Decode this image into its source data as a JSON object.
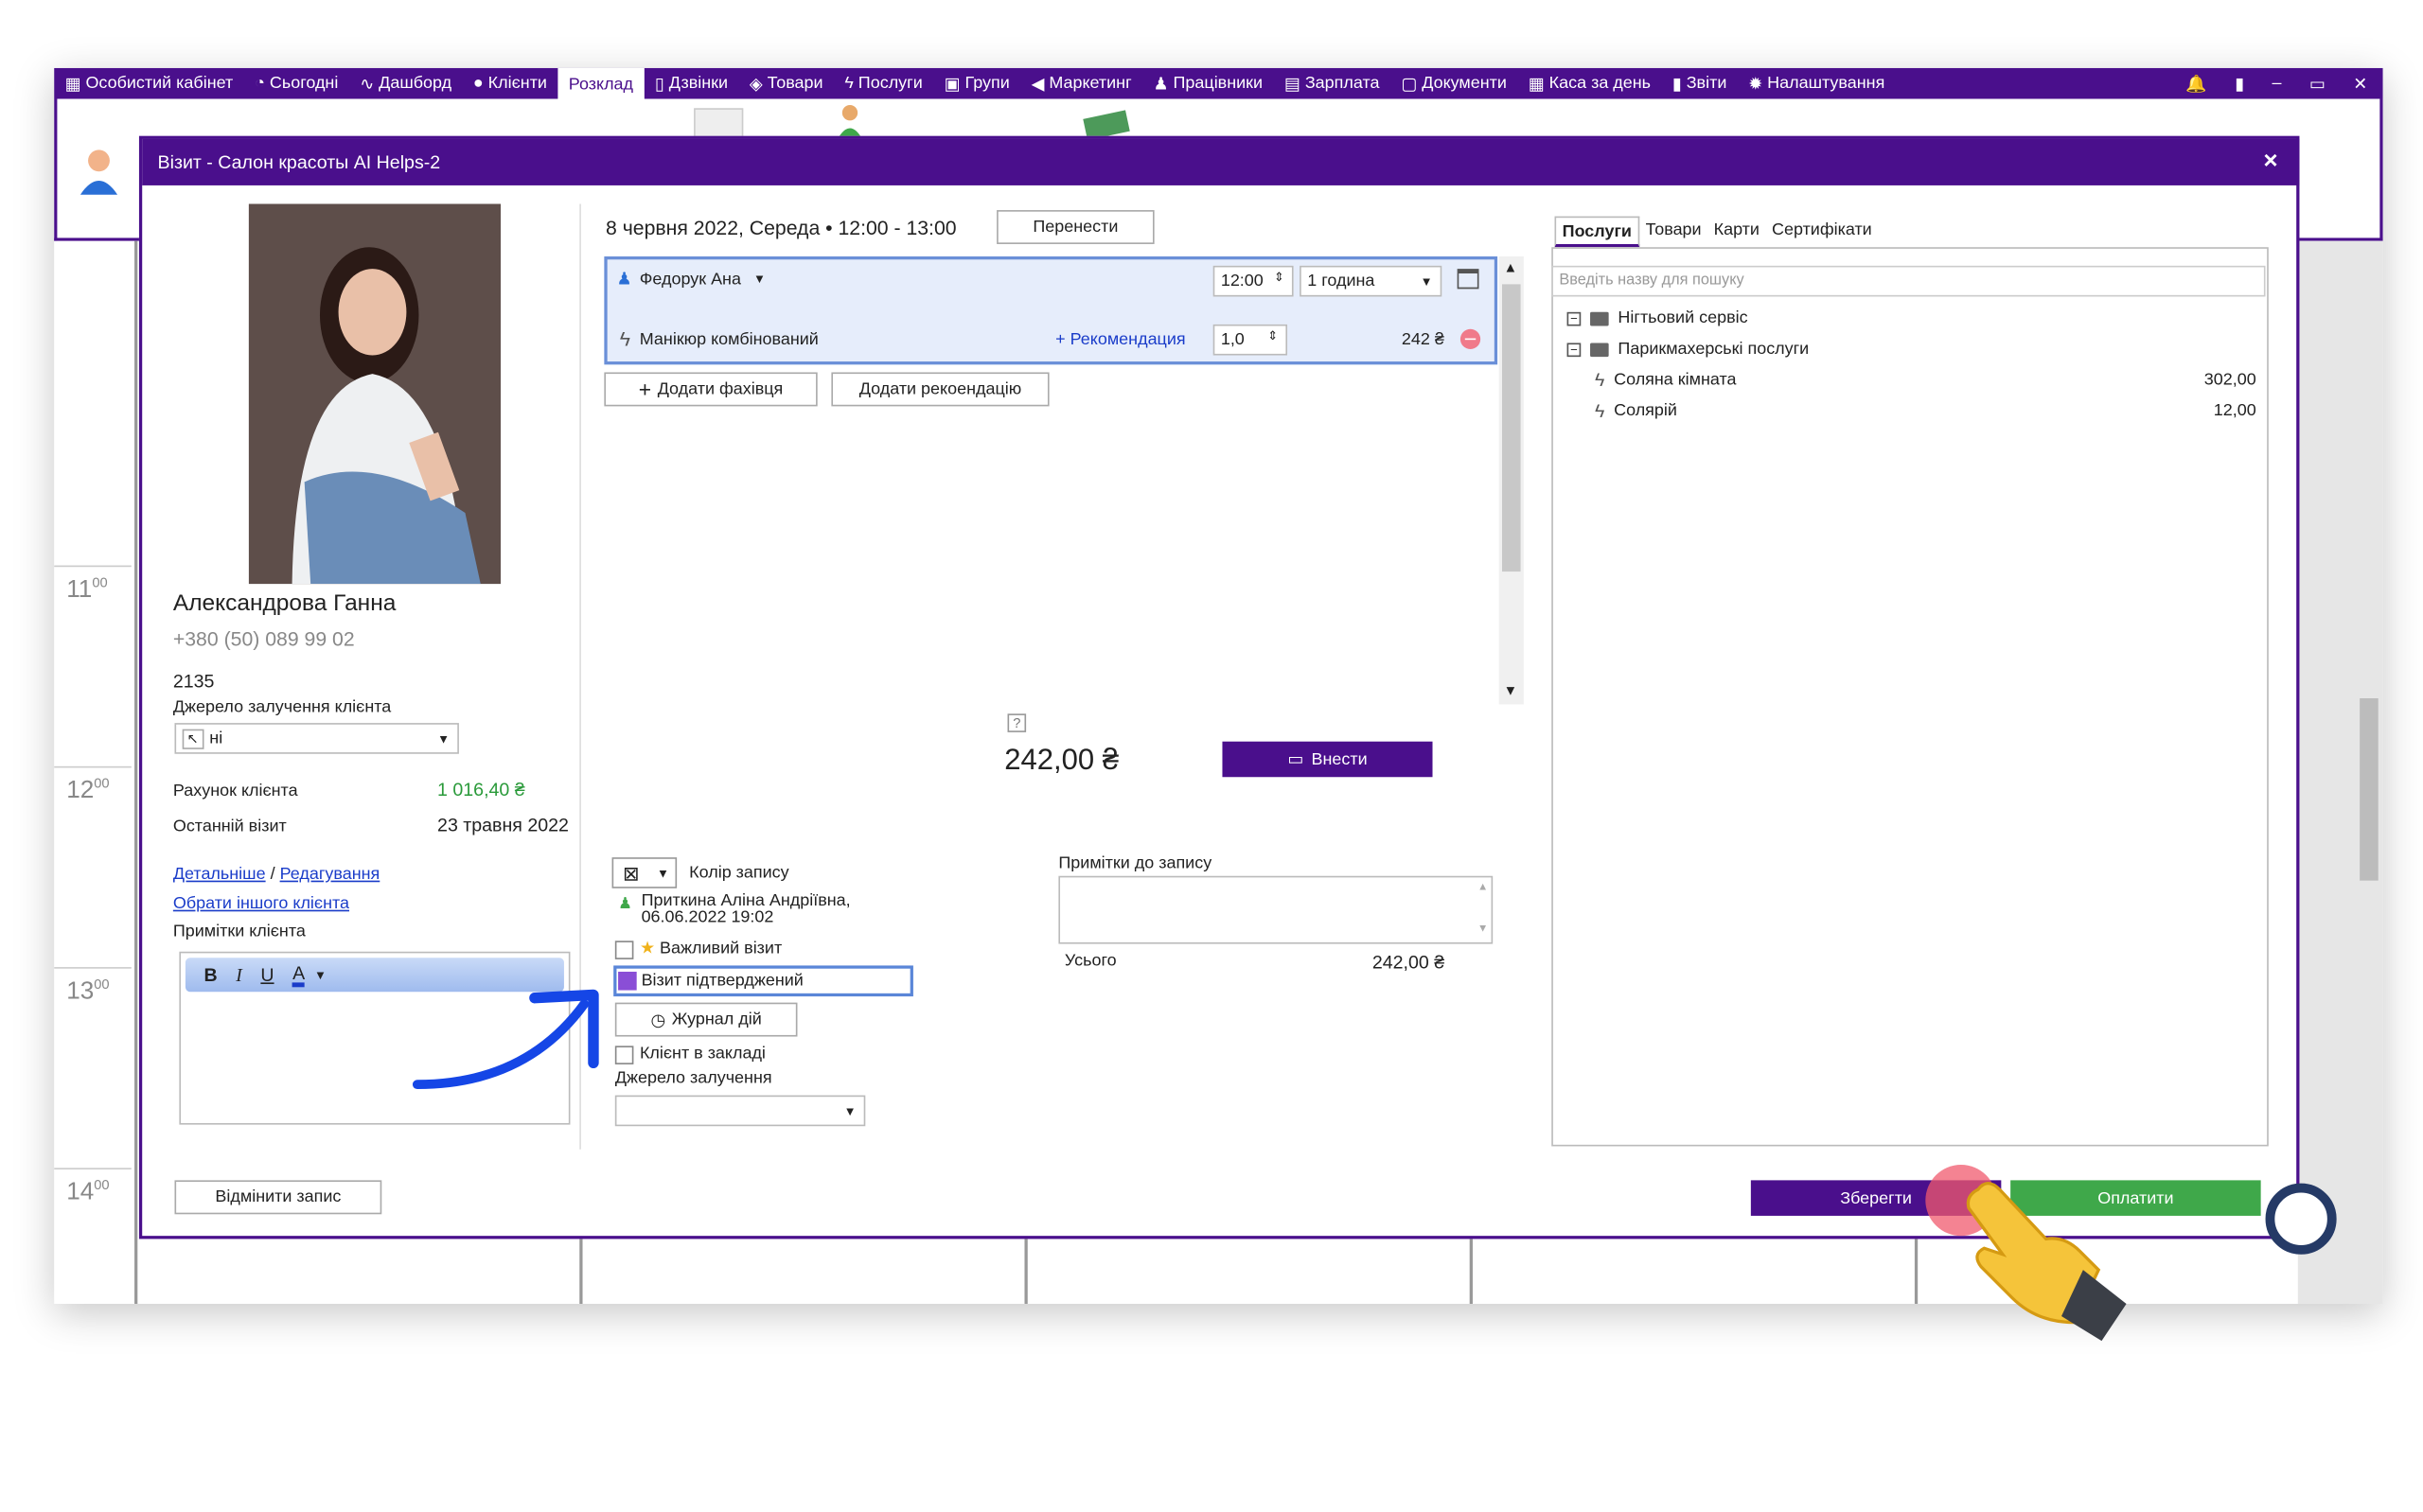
{
  "topmenu": [
    {
      "icon": "briefcase-icon",
      "glyph": "▦",
      "label": "Особистий кабінет"
    },
    {
      "icon": "clock-icon",
      "glyph": "◔",
      "label": "Сьогодні"
    },
    {
      "icon": "pulse-icon",
      "glyph": "∿",
      "label": "Дашборд"
    },
    {
      "icon": "user-circle-icon",
      "glyph": "●",
      "label": "Клієнти"
    },
    {
      "icon": "",
      "glyph": "",
      "label": "Розклад"
    },
    {
      "icon": "phone-icon",
      "glyph": "▯",
      "label": "Дзвінки"
    },
    {
      "icon": "box-icon",
      "glyph": "◈",
      "label": "Товари"
    },
    {
      "icon": "bolt-icon",
      "glyph": "ϟ",
      "label": "Послуги"
    },
    {
      "icon": "groups-icon",
      "glyph": "▣",
      "label": "Групи"
    },
    {
      "icon": "megaphone-icon",
      "glyph": "◀",
      "label": "Маркетинг"
    },
    {
      "icon": "person-icon",
      "glyph": "♟",
      "label": "Працівники"
    },
    {
      "icon": "money-icon",
      "glyph": "▤",
      "label": "Зарплата"
    },
    {
      "icon": "document-icon",
      "glyph": "▢",
      "label": "Документи"
    },
    {
      "icon": "calculator-icon",
      "glyph": "▦",
      "label": "Каса за день"
    },
    {
      "icon": "bars-icon",
      "glyph": "▮",
      "label": "Звіти"
    },
    {
      "icon": "gear-icon",
      "glyph": "✹",
      "label": "Налаштування"
    }
  ],
  "calendar_hours": [
    "11",
    "12",
    "13",
    "14"
  ],
  "calendar_minutes": "00",
  "modal": {
    "title": "Візит - Салон красоты AI Helps-2",
    "close": "×"
  },
  "client": {
    "name": "Александрова Ганна",
    "phone": "+380 (50) 089 99 02",
    "code": "2135",
    "source_label": "Джерело залучення клієнта",
    "source_value": "ні",
    "account_label": "Рахунок клієнта",
    "account_value": "1 016,40 ₴",
    "last_visit_label": "Останній візит",
    "last_visit_value": "23 травня 2022",
    "details_link": "Детальніше",
    "separator": "/",
    "edit_link": "Редагування",
    "choose_other_link": "Обрати іншого клієнта",
    "notes_label": "Примітки клієнта",
    "rte": {
      "bold": "B",
      "italic": "I",
      "underline": "U",
      "color": "A"
    }
  },
  "visit": {
    "datetime": "8 червня 2022, Середа • 12:00 - 13:00",
    "reschedule": "Перенести",
    "specialist": "Федорук Ана",
    "time": "12:00",
    "duration": "1 година",
    "service": "Манікюр комбінований",
    "recommendation": "+ Рекомендация",
    "qty": "1,0",
    "service_price": "242 ₴",
    "add_specialist": "Додати фахівця",
    "add_recommendation": "Додати рекоендацію",
    "help": "?",
    "total": "242,00 ₴",
    "deposit": "Внести",
    "color_label": "Колір запису",
    "created_by": "Приткина Аліна Андріївна,",
    "created_at": "06.06.2022 19:02",
    "important": "Важливий візит",
    "confirmed": "Візит підтверджений",
    "log": "Журнал дій",
    "client_in": "Клієнт в закладі",
    "source_label": "Джерело залучення",
    "notes_label": "Примітки до запису",
    "sum_label": "Усього",
    "sum_value": "242,00 ₴",
    "cancel": "Відмінити запис",
    "save": "Зберегти",
    "pay": "Оплатити"
  },
  "catalog": {
    "tabs": [
      "Послуги",
      "Товари",
      "Карти",
      "Сертифікати"
    ],
    "search_placeholder": "Введіть назву для пошуку",
    "folders": [
      "Нігтьовий сервіс",
      "Парикмахерські послуги"
    ],
    "items": [
      {
        "name": "Соляна кімната",
        "price": "302,00"
      },
      {
        "name": "Солярій",
        "price": "12,00"
      }
    ]
  },
  "colors": {
    "brand": "#4a0f8c",
    "pay": "#3fa84a",
    "account": "#2a9a3a",
    "arrow": "#1546e6"
  }
}
